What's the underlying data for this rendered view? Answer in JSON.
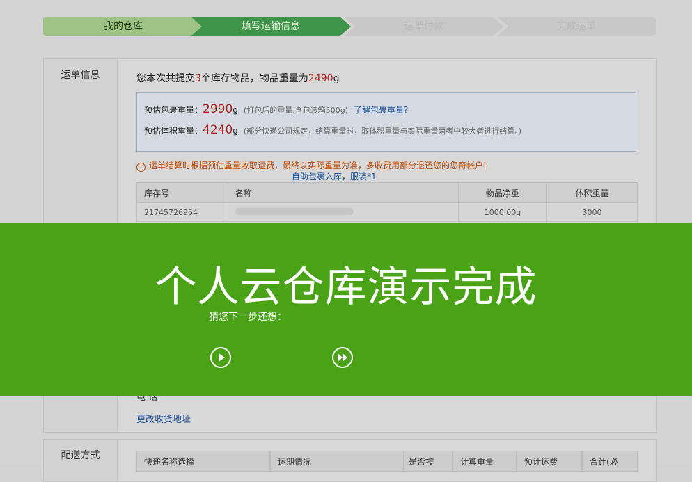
{
  "steps": [
    "我的仓库",
    "填写运输信息",
    "运单付款",
    "完成运单"
  ],
  "order_panel": {
    "side_label": "运单信息",
    "summary": {
      "prefix": "您本次共提交",
      "count": "3",
      "mid": "个库存物品，物品重量为",
      "weight": "2490",
      "unit": "g"
    },
    "estimate": {
      "pack_label": "预估包裹重量：",
      "pack_value": "2990",
      "pack_unit": "g",
      "pack_note": "(打包后的重量,含包装箱500g)",
      "pack_link": "了解包裹重量?",
      "vol_label": "预估体积重量：",
      "vol_value": "4240",
      "vol_unit": "g",
      "vol_note": "(部分快递公司规定，结算重量时，取体积重量与实际重量两者中较大者进行结算。)"
    },
    "warning": "运单结算时根据预估重量收取运费，最终以实际重量为准，多收费用部分退还您的您奇帐户!",
    "self_pack": "自助包裹入库，服装*1",
    "table": {
      "headers": [
        "库存号",
        "名称",
        "物品净重",
        "体积重量"
      ],
      "rows": [
        [
          "21745726954",
          "",
          "1000.00g",
          "3000"
        ]
      ]
    },
    "partial_text": "电    话",
    "change_address": "更改收货地址"
  },
  "delivery_panel": {
    "side_label": "配送方式",
    "headers": [
      "快递名称选择",
      "运期情况",
      "是否按",
      "计算重量",
      "预计运费",
      "合计(必"
    ]
  },
  "overlay": {
    "title": "个人云仓库演示完成",
    "subtitle": "猜您下一步还想：",
    "bg_color": "#4aa317"
  }
}
